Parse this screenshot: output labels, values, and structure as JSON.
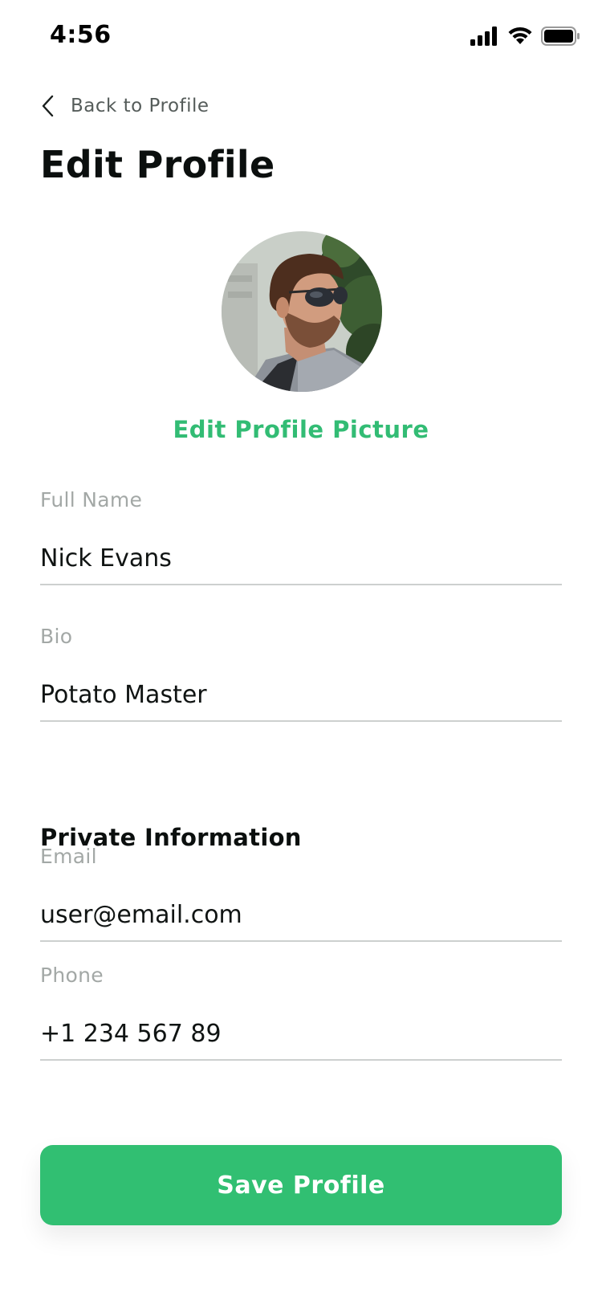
{
  "status_bar": {
    "time": "4:56",
    "icons": [
      "signal-icon",
      "wifi-icon",
      "battery-icon"
    ]
  },
  "nav": {
    "back_label": "Back to Profile",
    "back_icon": "chevron-left-icon"
  },
  "page_title": "Edit Profile",
  "avatar": {
    "edit_label": "Edit Profile Picture"
  },
  "public_fields": {
    "full_name": {
      "label": "Full Name",
      "value": "Nick Evans"
    },
    "bio": {
      "label": "Bio",
      "value": "Potato Master"
    }
  },
  "private_section": {
    "title": "Private Information",
    "email": {
      "label": "Email",
      "value": "user@email.com"
    },
    "phone": {
      "label": "Phone",
      "value": "+1 234 567 89"
    }
  },
  "save_button": {
    "label": "Save Profile"
  },
  "colors": {
    "accent": "#31bf72",
    "text_primary": "#0b0f0e",
    "text_muted": "#a3a8a6",
    "divider": "#cdd0cf"
  }
}
